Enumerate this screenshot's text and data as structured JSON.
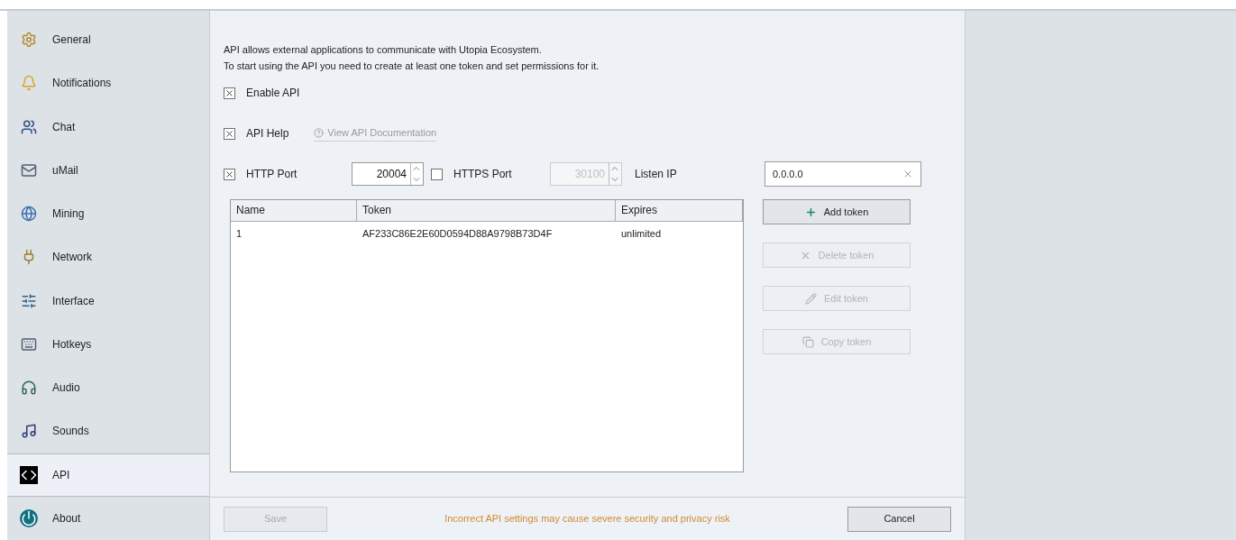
{
  "sidebar": {
    "items": [
      {
        "label": "General",
        "selected": false
      },
      {
        "label": "Notifications",
        "selected": false
      },
      {
        "label": "Chat",
        "selected": false
      },
      {
        "label": "uMail",
        "selected": false
      },
      {
        "label": "Mining",
        "selected": false
      },
      {
        "label": "Network",
        "selected": false
      },
      {
        "label": "Interface",
        "selected": false
      },
      {
        "label": "Hotkeys",
        "selected": false
      },
      {
        "label": "Audio",
        "selected": false
      },
      {
        "label": "Sounds",
        "selected": false
      },
      {
        "label": "API",
        "selected": true
      },
      {
        "label": "About",
        "selected": false
      }
    ]
  },
  "intro": [
    "API allows external applications to communicate with Utopia Ecosystem.",
    "To start using the API you need to create at least one token and set permissions for it."
  ],
  "enable_api": {
    "label": "Enable API",
    "checked": true
  },
  "api_help": {
    "label": "API Help",
    "checked": true,
    "link": "View API Documentation"
  },
  "http_port": {
    "label": "HTTP Port",
    "checked": true,
    "value": "20004",
    "disabled": false
  },
  "https_port": {
    "label": "HTTPS Port",
    "checked": false,
    "value": "30100",
    "disabled": true
  },
  "listen_ip": {
    "label": "Listen IP",
    "value": "0.0.0.0"
  },
  "table": {
    "columns": [
      "Name",
      "Token",
      "Expires"
    ],
    "rows": [
      [
        "1",
        "AF233C86E2E60D0594D88A9798B73D4F",
        "unlimited"
      ]
    ]
  },
  "token_buttons": [
    {
      "label": "Add token",
      "disabled": false
    },
    {
      "label": "Delete token",
      "disabled": true
    },
    {
      "label": "Edit token",
      "disabled": true
    },
    {
      "label": "Copy token",
      "disabled": true
    }
  ],
  "footer": {
    "save": {
      "label": "Save",
      "disabled": true
    },
    "warning": "Incorrect API settings may cause severe security and privacy risk",
    "cancel": {
      "label": "Cancel",
      "disabled": false
    }
  }
}
